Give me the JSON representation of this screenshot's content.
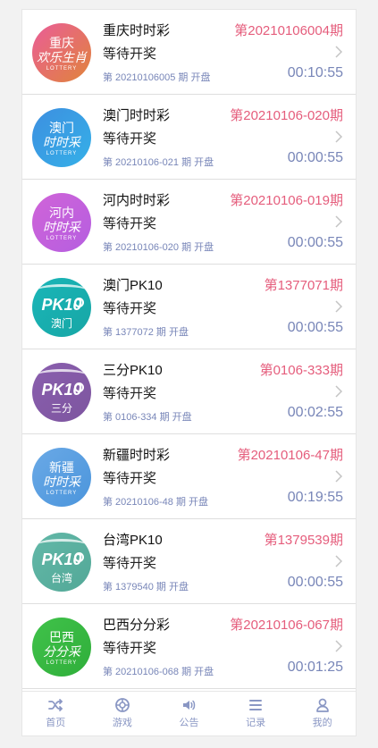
{
  "colors": {
    "period": "#e55d7c",
    "timer": "#7886b8",
    "tab": "#8a97c4"
  },
  "lotteries": [
    {
      "name": "重庆时时彩",
      "period": "第20210106004期",
      "status": "等待开奖",
      "next": "第 20210106005 期 开盘",
      "timer": "00:10:55",
      "logo": {
        "line1": "重庆",
        "line2": "欢乐生肖",
        "line3": "LOTTERY",
        "colors": [
          "#ea5d98",
          "#e0843a"
        ],
        "type": "text"
      }
    },
    {
      "name": "澳门时时彩",
      "period": "第20210106-020期",
      "status": "等待开奖",
      "next": "第 20210106-021 期 开盘",
      "timer": "00:00:55",
      "logo": {
        "line1": "澳门",
        "line2": "时时采",
        "line3": "LOTTERY",
        "colors": [
          "#3d8fe0",
          "#35b0e8"
        ],
        "type": "text"
      }
    },
    {
      "name": "河内时时彩",
      "period": "第20210106-019期",
      "status": "等待开奖",
      "next": "第 20210106-020 期 开盘",
      "timer": "00:00:55",
      "logo": {
        "line1": "河内",
        "line2": "时时采",
        "line3": "LOTTERY",
        "colors": [
          "#d064d8",
          "#b55ee0"
        ],
        "type": "text"
      }
    },
    {
      "name": "澳门PK10",
      "period": "第1377071期",
      "status": "等待开奖",
      "next": "第 1377072 期 开盘",
      "timer": "00:00:55",
      "logo": {
        "line1": "PK10",
        "line2": "澳门",
        "line3": "",
        "colors": [
          "#1ab6b8",
          "#17a6a5"
        ],
        "type": "pk"
      }
    },
    {
      "name": "三分PK10",
      "period": "第0106-333期",
      "status": "等待开奖",
      "next": "第 0106-334 期 开盘",
      "timer": "00:02:55",
      "logo": {
        "line1": "PK10",
        "line2": "三分",
        "line3": "",
        "colors": [
          "#8a5fae",
          "#7d559f"
        ],
        "type": "pk"
      }
    },
    {
      "name": "新疆时时彩",
      "period": "第20210106-47期",
      "status": "等待开奖",
      "next": "第 20210106-48 期 开盘",
      "timer": "00:19:55",
      "logo": {
        "line1": "新疆",
        "line2": "时时采",
        "line3": "LOTTERY",
        "colors": [
          "#6aa9e6",
          "#4b95dc"
        ],
        "type": "text"
      }
    },
    {
      "name": "台湾PK10",
      "period": "第1379539期",
      "status": "等待开奖",
      "next": "第 1379540 期 开盘",
      "timer": "00:00:55",
      "logo": {
        "line1": "PK10",
        "line2": "台湾",
        "line3": "",
        "colors": [
          "#62b8a8",
          "#53a897"
        ],
        "type": "pk"
      }
    },
    {
      "name": "巴西分分彩",
      "period": "第20210106-067期",
      "status": "等待开奖",
      "next": "第 20210106-068 期 开盘",
      "timer": "00:01:25",
      "logo": {
        "line1": "巴西",
        "line2": "分分采",
        "line3": "LOTTERY",
        "colors": [
          "#40c24a",
          "#2fae3a"
        ],
        "type": "text"
      }
    }
  ],
  "tabbar": [
    {
      "label": "首页",
      "icon": "shuffle-icon"
    },
    {
      "label": "游戏",
      "icon": "game-icon"
    },
    {
      "label": "公告",
      "icon": "speaker-icon"
    },
    {
      "label": "记录",
      "icon": "list-icon"
    },
    {
      "label": "我的",
      "icon": "user-icon"
    }
  ]
}
